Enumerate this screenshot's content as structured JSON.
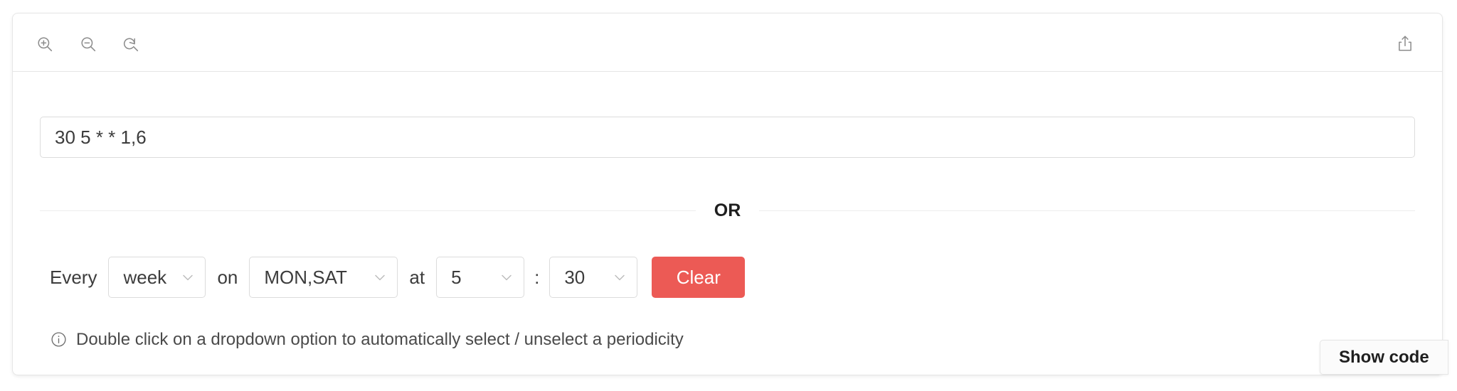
{
  "toolbar": {
    "zoom_in": {
      "name": "zoom-in-icon",
      "title": "Zoom in"
    },
    "zoom_out": {
      "name": "zoom-out-icon",
      "title": "Zoom out"
    },
    "reset": {
      "name": "zoom-reset-icon",
      "title": "Reset zoom"
    },
    "share": {
      "name": "share-icon",
      "title": "Share"
    }
  },
  "cron": {
    "value": "30 5 * * 1,6",
    "placeholder": "* * * * *"
  },
  "divider": {
    "text": "OR"
  },
  "builder": {
    "every_label": "Every",
    "period": "week",
    "on_label": "on",
    "days": "MON,SAT",
    "at_label": "at",
    "hour": "5",
    "time_separator": ":",
    "minute": "30",
    "clear_label": "Clear"
  },
  "hint": {
    "icon": "info-circle-icon",
    "text": "Double click on a dropdown option to automatically select / unselect a periodicity"
  },
  "footer": {
    "show_code_label": "Show code"
  },
  "colors": {
    "clear_button": "#ec5a55",
    "card_border": "#e6e6e6",
    "field_border": "#dcdcdc",
    "text": "#3c3c3c",
    "icon": "#8c8c8c"
  }
}
